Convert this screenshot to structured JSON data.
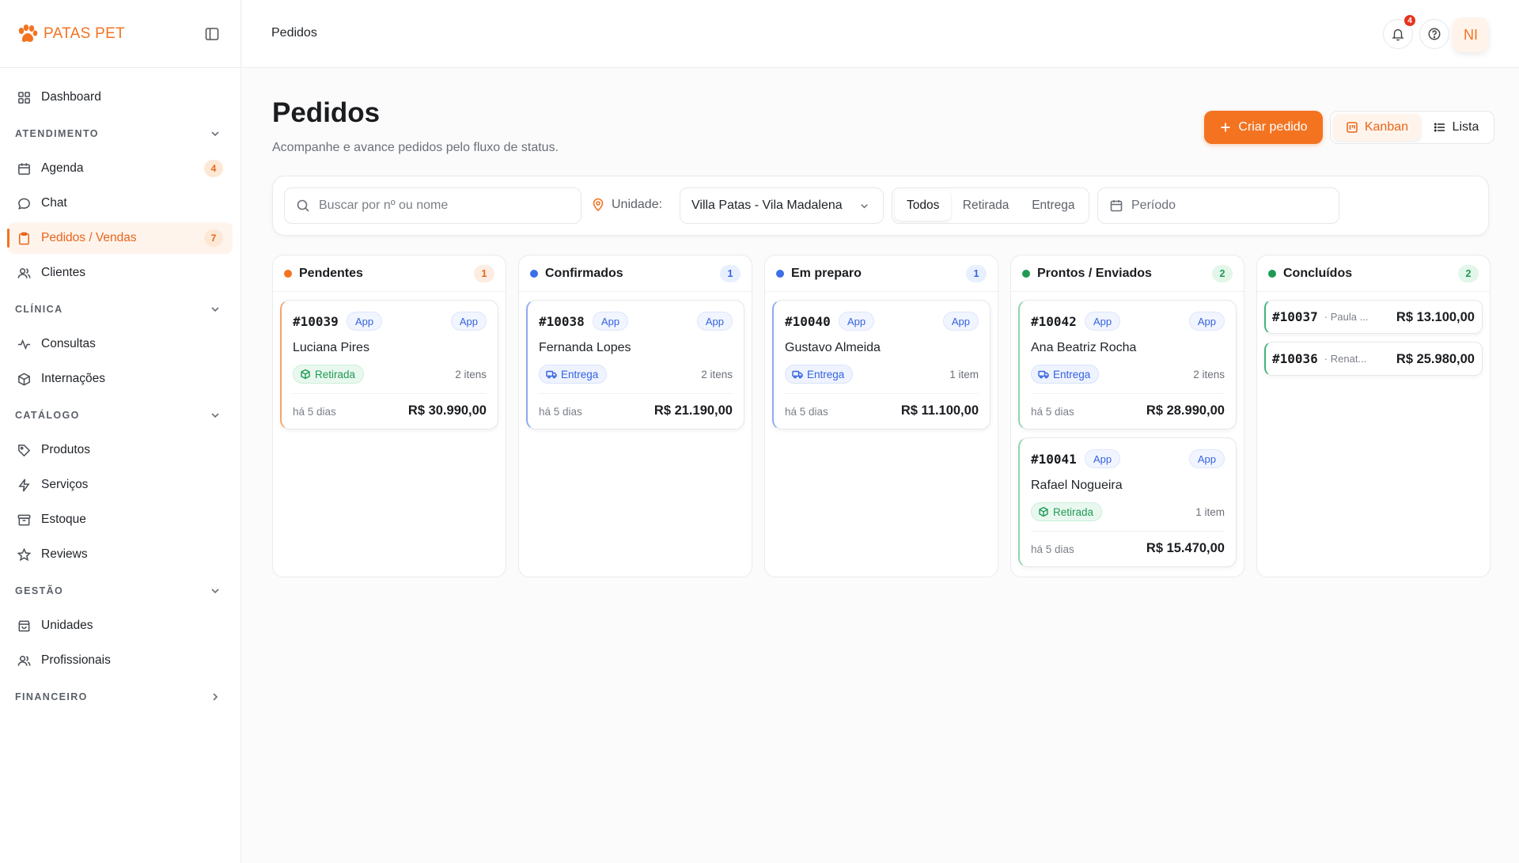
{
  "brand": {
    "name": "PATAS PET"
  },
  "sidebar": {
    "dashboard": "Dashboard",
    "atendimento": {
      "title": "ATENDIMENTO",
      "agenda": "Agenda",
      "agenda_badge": "4",
      "chat": "Chat",
      "pedidos": "Pedidos / Vendas",
      "pedidos_badge": "7",
      "clientes": "Clientes"
    },
    "clinica": {
      "title": "CLÍNICA",
      "consultas": "Consultas",
      "internacoes": "Internações"
    },
    "catalogo": {
      "title": "CATÁLOGO",
      "produtos": "Produtos",
      "servicos": "Serviços",
      "estoque": "Estoque",
      "reviews": "Reviews"
    },
    "gestao": {
      "title": "GESTÃO",
      "unidades": "Unidades",
      "profissionais": "Profissionais"
    },
    "financeiro": {
      "title": "FINANCEIRO"
    }
  },
  "topbar": {
    "breadcrumb": "Pedidos",
    "notifications": "4",
    "avatar": "NI"
  },
  "page": {
    "title": "Pedidos",
    "subtitle": "Acompanhe e avance pedidos pelo fluxo de status.",
    "create_label": "Criar pedido",
    "view_kanban": "Kanban",
    "view_lista": "Lista"
  },
  "filters": {
    "search_placeholder": "Buscar por nº ou nome",
    "unit_label": "Unidade:",
    "unit_value": "Villa Patas - Vila Madalena",
    "type_all": "Todos",
    "type_pickup": "Retirada",
    "type_delivery": "Entrega",
    "period_placeholder": "Período"
  },
  "colors": {
    "accent": "#f37321",
    "pendentes": "#f37321",
    "confirmados": "#3b6fe6",
    "em_preparo": "#3b6fe6",
    "prontos": "#1f9a55",
    "concluidos": "#1f9a55"
  },
  "board": {
    "pendentes": {
      "title": "Pendentes",
      "count": "1",
      "cards": [
        {
          "number": "#10039",
          "channel": "App",
          "channel_tag": "App",
          "customer": "Luciana Pires",
          "type": "Retirada",
          "items": "2 itens",
          "age": "há 5 dias",
          "total": "R$ 30.990,00"
        }
      ]
    },
    "confirmados": {
      "title": "Confirmados",
      "count": "1",
      "cards": [
        {
          "number": "#10038",
          "channel": "App",
          "channel_tag": "App",
          "customer": "Fernanda Lopes",
          "type": "Entrega",
          "items": "2 itens",
          "age": "há 5 dias",
          "total": "R$ 21.190,00"
        }
      ]
    },
    "em_preparo": {
      "title": "Em preparo",
      "count": "1",
      "cards": [
        {
          "number": "#10040",
          "channel": "App",
          "channel_tag": "App",
          "customer": "Gustavo Almeida",
          "type": "Entrega",
          "items": "1 item",
          "age": "há 5 dias",
          "total": "R$ 11.100,00"
        }
      ]
    },
    "prontos": {
      "title": "Prontos / Enviados",
      "count": "2",
      "cards": [
        {
          "number": "#10042",
          "channel": "App",
          "channel_tag": "App",
          "customer": "Ana Beatriz Rocha",
          "type": "Entrega",
          "items": "2 itens",
          "age": "há 5 dias",
          "total": "R$ 28.990,00"
        },
        {
          "number": "#10041",
          "channel": "App",
          "channel_tag": "App",
          "customer": "Rafael Nogueira",
          "type": "Retirada",
          "items": "1 item",
          "age": "há 5 dias",
          "total": "R$ 15.470,00"
        }
      ]
    },
    "concluidos": {
      "title": "Concluídos",
      "count": "2",
      "cards": [
        {
          "number": "#10037",
          "customer_short": "· Paula ...",
          "total": "R$ 13.100,00"
        },
        {
          "number": "#10036",
          "customer_short": "· Renat...",
          "total": "R$ 25.980,00"
        }
      ]
    }
  }
}
